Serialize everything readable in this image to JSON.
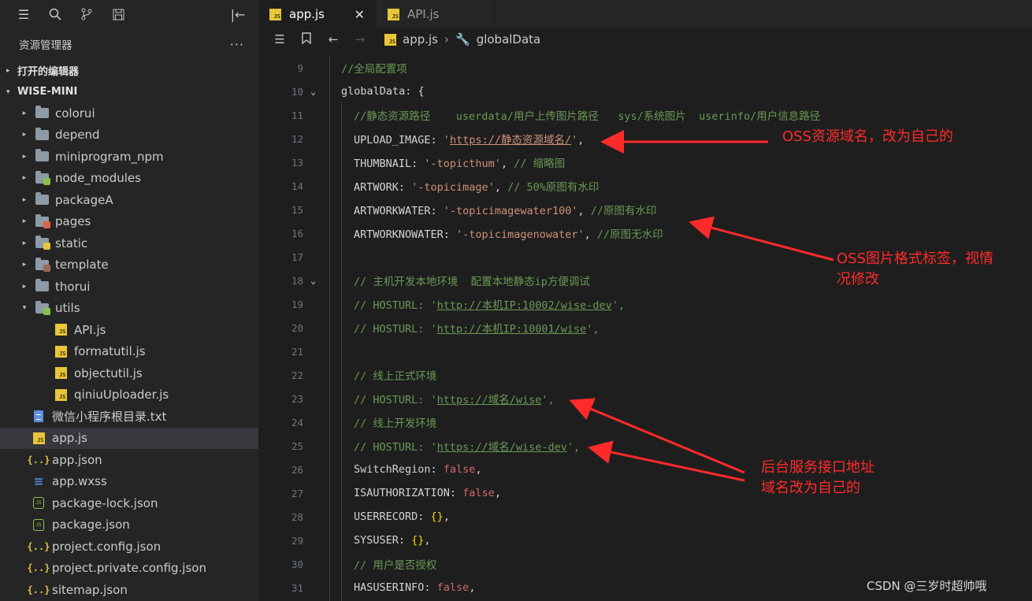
{
  "sidebar": {
    "title": "资源管理器",
    "more": "···",
    "open_editors": "打开的编辑器",
    "project": "WISE-MINI",
    "items": [
      {
        "label": "colorui",
        "type": "folder",
        "twisty": "▸"
      },
      {
        "label": "depend",
        "type": "folder",
        "twisty": "▸"
      },
      {
        "label": "miniprogram_npm",
        "type": "folder",
        "twisty": "▸"
      },
      {
        "label": "node_modules",
        "type": "folder",
        "twisty": "▸",
        "badge": "#8cc24a"
      },
      {
        "label": "packageA",
        "type": "folder",
        "twisty": "▸"
      },
      {
        "label": "pages",
        "type": "folder",
        "twisty": "▸",
        "badge": "#e0624a"
      },
      {
        "label": "static",
        "type": "folder",
        "twisty": "▸",
        "badge": "#e8c53a"
      },
      {
        "label": "template",
        "type": "folder",
        "twisty": "▸",
        "badge": "#a0685a"
      },
      {
        "label": "thorui",
        "type": "folder",
        "twisty": "▸"
      },
      {
        "label": "utils",
        "type": "folder",
        "twisty": "▾",
        "badge": "#8cc24a"
      },
      {
        "label": "API.js",
        "type": "js",
        "indent": 2
      },
      {
        "label": "formatutil.js",
        "type": "js",
        "indent": 2
      },
      {
        "label": "objectutil.js",
        "type": "js",
        "indent": 2
      },
      {
        "label": "qiniuUploader.js",
        "type": "js",
        "indent": 2
      },
      {
        "label": "微信小程序根目录.txt",
        "type": "txt"
      },
      {
        "label": "app.js",
        "type": "js",
        "selected": true
      },
      {
        "label": "app.json",
        "type": "json"
      },
      {
        "label": "app.wxss",
        "type": "css"
      },
      {
        "label": "package-lock.json",
        "type": "node"
      },
      {
        "label": "package.json",
        "type": "node"
      },
      {
        "label": "project.config.json",
        "type": "json"
      },
      {
        "label": "project.private.config.json",
        "type": "json"
      },
      {
        "label": "sitemap.json",
        "type": "json"
      }
    ]
  },
  "tabs": [
    {
      "label": "app.js",
      "active": true,
      "close": "✕"
    },
    {
      "label": "API.js",
      "active": false
    }
  ],
  "breadcrumb": {
    "file": "app.js",
    "symbol": "globalData"
  },
  "code_lines": [
    {
      "n": "9",
      "tokens": [
        {
          "t": "//全局配置项",
          "c": "c-com"
        }
      ],
      "indent": 0
    },
    {
      "n": "10",
      "fold": "⌄",
      "tokens": [
        {
          "t": "globalData: ",
          "c": "c-key"
        },
        {
          "t": "{",
          "c": "c-punc"
        }
      ],
      "indent": 0
    },
    {
      "n": "11",
      "tokens": [
        {
          "t": "//静态资源路径    userdata/用户上传图片路径   sys/系统图片  userinfo/用户信息路径",
          "c": "c-com"
        }
      ],
      "indent": 1
    },
    {
      "n": "12",
      "tokens": [
        {
          "t": "UPLOAD_IMAGE: ",
          "c": "c-key"
        },
        {
          "t": "'",
          "c": "c-str"
        },
        {
          "t": "https://静态资源域名/",
          "c": "c-url"
        },
        {
          "t": "'",
          "c": "c-str"
        },
        {
          "t": ",",
          "c": "c-punc"
        }
      ],
      "indent": 1
    },
    {
      "n": "13",
      "tokens": [
        {
          "t": "THUMBNAIL: ",
          "c": "c-key"
        },
        {
          "t": "'-topicthum'",
          "c": "c-str"
        },
        {
          "t": ", ",
          "c": "c-punc"
        },
        {
          "t": "// 缩略图",
          "c": "c-com"
        }
      ],
      "indent": 1
    },
    {
      "n": "14",
      "tokens": [
        {
          "t": "ARTWORK: ",
          "c": "c-key"
        },
        {
          "t": "'-topicimage'",
          "c": "c-str"
        },
        {
          "t": ", ",
          "c": "c-punc"
        },
        {
          "t": "// 50%原图有水印",
          "c": "c-com"
        }
      ],
      "indent": 1
    },
    {
      "n": "15",
      "tokens": [
        {
          "t": "ARTWORKWATER: ",
          "c": "c-key"
        },
        {
          "t": "'-topicimagewater100'",
          "c": "c-str"
        },
        {
          "t": ", ",
          "c": "c-punc"
        },
        {
          "t": "//原图有水印",
          "c": "c-com"
        }
      ],
      "indent": 1
    },
    {
      "n": "16",
      "tokens": [
        {
          "t": "ARTWORKNOWATER: ",
          "c": "c-key"
        },
        {
          "t": "'-topicimagenowater'",
          "c": "c-str"
        },
        {
          "t": ", ",
          "c": "c-punc"
        },
        {
          "t": "//原图无水印",
          "c": "c-com"
        }
      ],
      "indent": 1
    },
    {
      "n": "17",
      "tokens": [],
      "indent": 1
    },
    {
      "n": "18",
      "fold": "⌄",
      "tokens": [
        {
          "t": "// 主机开发本地环境  配置本地静态ip方便调试",
          "c": "c-com"
        }
      ],
      "indent": 1
    },
    {
      "n": "19",
      "tokens": [
        {
          "t": "// HOSTURL: '",
          "c": "c-com"
        },
        {
          "t": "http://本机IP:10002/wise-dev",
          "c": "c-url-green"
        },
        {
          "t": "',",
          "c": "c-com"
        }
      ],
      "indent": 1
    },
    {
      "n": "20",
      "tokens": [
        {
          "t": "// HOSTURL: '",
          "c": "c-com"
        },
        {
          "t": "http://本机IP:10001/wise",
          "c": "c-url-green"
        },
        {
          "t": "',",
          "c": "c-com"
        }
      ],
      "indent": 1
    },
    {
      "n": "21",
      "tokens": [],
      "indent": 1
    },
    {
      "n": "22",
      "tokens": [
        {
          "t": "// 线上正式环境",
          "c": "c-com"
        }
      ],
      "indent": 1
    },
    {
      "n": "23",
      "tokens": [
        {
          "t": "// HOSTURL: '",
          "c": "c-com"
        },
        {
          "t": "https://域名/wise",
          "c": "c-url-green"
        },
        {
          "t": "',",
          "c": "c-com"
        }
      ],
      "indent": 1
    },
    {
      "n": "24",
      "tokens": [
        {
          "t": "// 线上开发环境",
          "c": "c-com"
        }
      ],
      "indent": 1
    },
    {
      "n": "25",
      "tokens": [
        {
          "t": "// HOSTURL: '",
          "c": "c-com"
        },
        {
          "t": "https://域名/wise-dev",
          "c": "c-url-green"
        },
        {
          "t": "',",
          "c": "c-com"
        }
      ],
      "indent": 1
    },
    {
      "n": "26",
      "tokens": [
        {
          "t": "SwitchRegion: ",
          "c": "c-key"
        },
        {
          "t": "false",
          "c": "c-kw"
        },
        {
          "t": ",",
          "c": "c-punc"
        }
      ],
      "indent": 1
    },
    {
      "n": "27",
      "tokens": [
        {
          "t": "ISAUTHORIZATION: ",
          "c": "c-key"
        },
        {
          "t": "false",
          "c": "c-kw"
        },
        {
          "t": ",",
          "c": "c-punc"
        }
      ],
      "indent": 1
    },
    {
      "n": "28",
      "tokens": [
        {
          "t": "USERRECORD: ",
          "c": "c-key"
        },
        {
          "t": "{}",
          "c": "c-brace"
        },
        {
          "t": ",",
          "c": "c-punc"
        }
      ],
      "indent": 1
    },
    {
      "n": "29",
      "tokens": [
        {
          "t": "SYSUSER: ",
          "c": "c-key"
        },
        {
          "t": "{}",
          "c": "c-brace"
        },
        {
          "t": ",",
          "c": "c-punc"
        }
      ],
      "indent": 1
    },
    {
      "n": "30",
      "tokens": [
        {
          "t": "// 用户是否授权",
          "c": "c-com"
        }
      ],
      "indent": 1
    },
    {
      "n": "31",
      "tokens": [
        {
          "t": "HASUSERINFO: ",
          "c": "c-key"
        },
        {
          "t": "false",
          "c": "c-kw"
        },
        {
          "t": ",",
          "c": "c-punc"
        }
      ],
      "indent": 1
    }
  ],
  "annotations": {
    "oss_domain": "OSS资源域名，改为自己的",
    "oss_format": "OSS图片格式标签，视情\n况修改",
    "backend": "后台服务接口地址\n域名改为自己的"
  },
  "watermark": "CSDN @三岁时超帅哦",
  "colors": {
    "annotation": "#ff2a2a",
    "comment": "#6a9955",
    "string": "#ce9178",
    "keyword": "#d16969"
  }
}
